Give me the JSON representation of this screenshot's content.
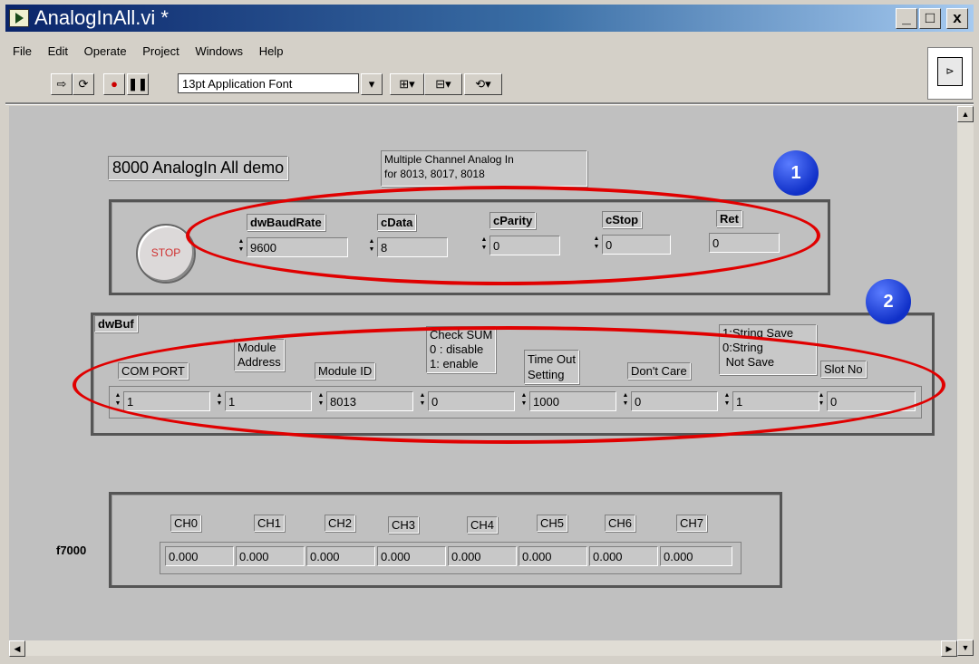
{
  "window": {
    "title": "AnalogInAll.vi *",
    "minimize": "_",
    "maximize": "□",
    "close": "x"
  },
  "menu": [
    "File",
    "Edit",
    "Operate",
    "Project",
    "Windows",
    "Help"
  ],
  "toolbar": {
    "font": "13pt Application Font"
  },
  "panel": {
    "demo_title": "8000 AnalogIn All demo",
    "description_line1": "Multiple Channel Analog In",
    "description_line2": "for 8013, 8017, 8018",
    "stop_label": "STOP",
    "serial": {
      "dwBaudRate": {
        "label": "dwBaudRate",
        "value": "9600"
      },
      "cData": {
        "label": "cData",
        "value": "8"
      },
      "cParity": {
        "label": "cParity",
        "value": "0"
      },
      "cStop": {
        "label": "cStop",
        "value": "0"
      },
      "Ret": {
        "label": "Ret",
        "value": "0"
      }
    },
    "dwbuf": {
      "label": "dwBuf",
      "columns": [
        {
          "header": "COM PORT",
          "value": "1"
        },
        {
          "header": "Module\nAddress",
          "value": "1"
        },
        {
          "header": "Module ID",
          "value": "8013"
        },
        {
          "header": "Check SUM\n0 : disable\n1: enable",
          "value": "0"
        },
        {
          "header": "Time Out\nSetting",
          "value": "1000"
        },
        {
          "header": "Don't Care",
          "value": "0"
        },
        {
          "header": "1:String Save\n0:String\n Not Save",
          "value": "1"
        },
        {
          "header": "Slot No",
          "value": "0"
        }
      ]
    },
    "f7000": {
      "label": "f7000",
      "channels": [
        {
          "header": "CH0",
          "value": "0.000"
        },
        {
          "header": "CH1",
          "value": "0.000"
        },
        {
          "header": "CH2",
          "value": "0.000"
        },
        {
          "header": "CH3",
          "value": "0.000"
        },
        {
          "header": "CH4",
          "value": "0.000"
        },
        {
          "header": "CH5",
          "value": "0.000"
        },
        {
          "header": "CH6",
          "value": "0.000"
        },
        {
          "header": "CH7",
          "value": "0.000"
        }
      ]
    },
    "callouts": [
      "1",
      "2"
    ],
    "colors": {
      "highlight": "#e00000",
      "callout": "#1f3fe0"
    }
  }
}
